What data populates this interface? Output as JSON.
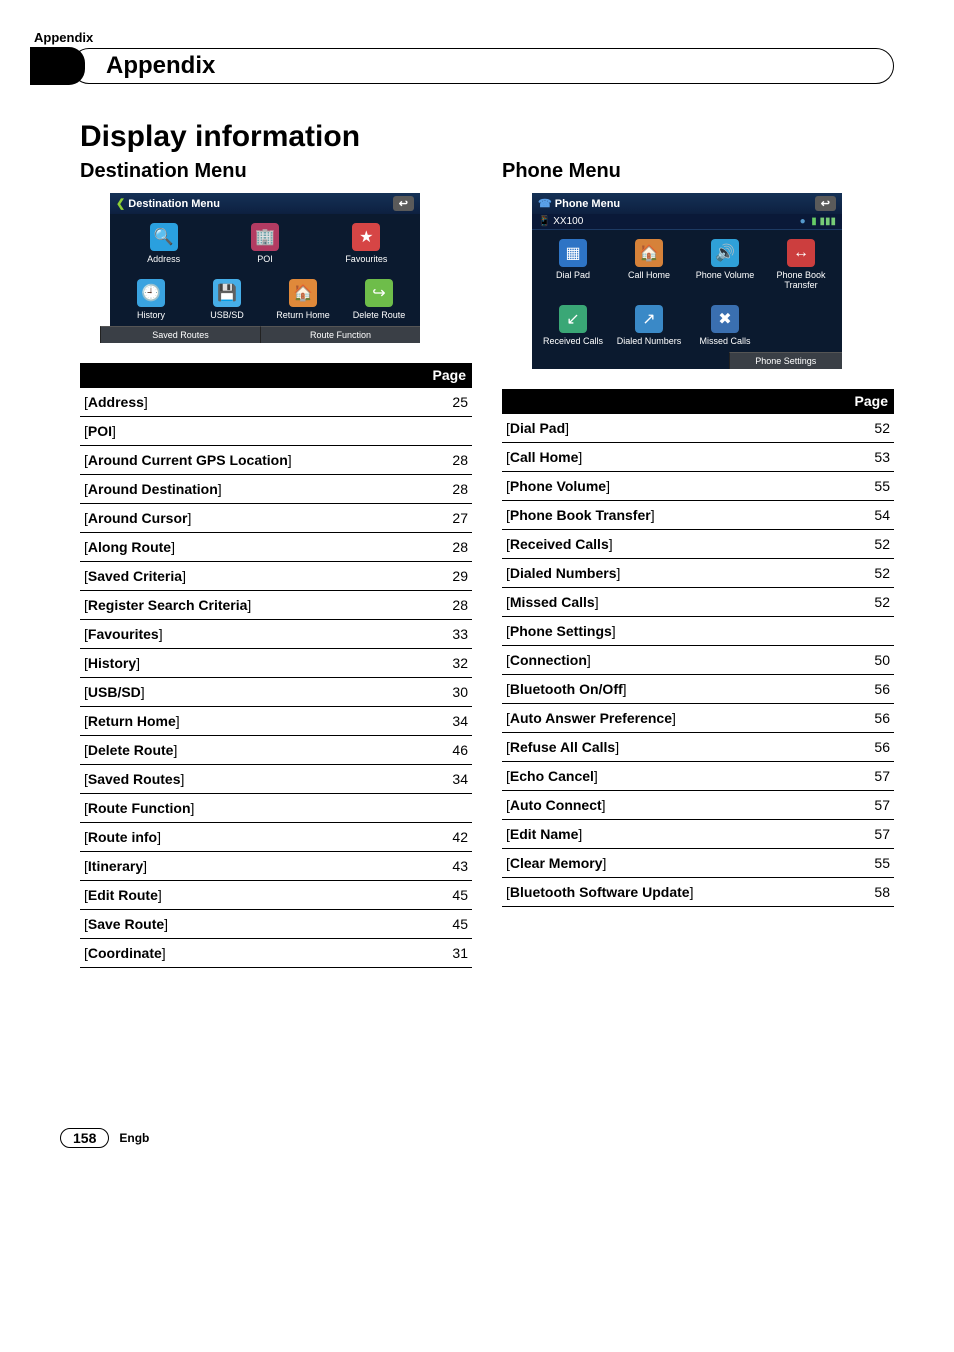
{
  "section_tag": "Appendix",
  "chapter_title": "Appendix",
  "main_heading": "Display information",
  "page_number": "158",
  "language": "Engb",
  "left": {
    "sub_heading": "Destination Menu",
    "screenshot": {
      "title": "Destination Menu",
      "back_icon": "↩",
      "row1": [
        {
          "icon": "🔍",
          "bg": "#2aa0df",
          "label": "Address"
        },
        {
          "icon": "🏢",
          "bg": "#b33b62",
          "label": "POI"
        },
        {
          "icon": "★",
          "bg": "#d64545",
          "label": "Favourites"
        }
      ],
      "row2": [
        {
          "icon": "🕘",
          "bg": "#3aa3e0",
          "label": "History"
        },
        {
          "icon": "💾",
          "bg": "#46aee8",
          "label": "USB/SD"
        },
        {
          "icon": "🏠",
          "bg": "#e0893a",
          "label": "Return Home"
        },
        {
          "icon": "↪",
          "bg": "#6ebd4a",
          "label": "Delete Route"
        }
      ],
      "footer": [
        "Saved Routes",
        "Route Function"
      ]
    },
    "table_header": "Page",
    "rows": [
      {
        "level": 0,
        "label": "Address",
        "page": "25"
      },
      {
        "level": 0,
        "label": "POI",
        "page": ""
      },
      {
        "level": 1,
        "label": "Around Current GPS Location",
        "page": "28"
      },
      {
        "level": 1,
        "label": "Around Destination",
        "page": "28"
      },
      {
        "level": 1,
        "label": "Around Cursor",
        "page": "27"
      },
      {
        "level": 1,
        "label": "Along Route",
        "page": "28"
      },
      {
        "level": 1,
        "label": "Saved Criteria",
        "page": "29"
      },
      {
        "level": 1,
        "label": "Register Search Criteria",
        "page": "28"
      },
      {
        "level": 0,
        "label": "Favourites",
        "page": "33"
      },
      {
        "level": 0,
        "label": "History",
        "page": "32"
      },
      {
        "level": 0,
        "label": "USB/SD",
        "page": "30"
      },
      {
        "level": 0,
        "label": "Return Home",
        "page": "34"
      },
      {
        "level": 0,
        "label": "Delete Route",
        "page": "46"
      },
      {
        "level": 0,
        "label": "Saved Routes",
        "page": "34"
      },
      {
        "level": 0,
        "label": "Route Function",
        "page": ""
      },
      {
        "level": 1,
        "label": "Route info",
        "page": "42"
      },
      {
        "level": 1,
        "label": "Itinerary",
        "page": "43"
      },
      {
        "level": 1,
        "label": "Edit Route",
        "page": "45"
      },
      {
        "level": 1,
        "label": "Save Route",
        "page": "45"
      },
      {
        "level": 1,
        "label": "Coordinate",
        "page": "31"
      }
    ]
  },
  "right": {
    "sub_heading": "Phone Menu",
    "screenshot": {
      "title": "Phone Menu",
      "back_icon": "↩",
      "status_left": "XX100",
      "row1": [
        {
          "icon": "▦",
          "bg": "#2e74c5",
          "label": "Dial Pad"
        },
        {
          "icon": "🏠",
          "bg": "#d6823a",
          "label": "Call Home"
        },
        {
          "icon": "🔊",
          "bg": "#2fa0d8",
          "label": "Phone Volume"
        },
        {
          "icon": "↔",
          "bg": "#cc3e3e",
          "label": "Phone Book Transfer"
        }
      ],
      "row2": [
        {
          "icon": "↙",
          "bg": "#3aa776",
          "label": "Received Calls"
        },
        {
          "icon": "↗",
          "bg": "#3a89c7",
          "label": "Dialed Numbers"
        },
        {
          "icon": "✖",
          "bg": "#3a6fb0",
          "label": "Missed Calls"
        },
        {
          "icon": "",
          "bg": "transparent",
          "label": ""
        }
      ],
      "footer_single": "Phone Settings"
    },
    "table_header": "Page",
    "rows": [
      {
        "level": 0,
        "label": "Dial Pad",
        "page": "52"
      },
      {
        "level": 0,
        "label": "Call Home",
        "page": "53"
      },
      {
        "level": 0,
        "label": "Phone Volume",
        "page": "55"
      },
      {
        "level": 0,
        "label": "Phone Book Transfer",
        "page": "54"
      },
      {
        "level": 0,
        "label": "Received Calls",
        "page": "52"
      },
      {
        "level": 0,
        "label": "Dialed Numbers",
        "page": "52"
      },
      {
        "level": 0,
        "label": "Missed Calls",
        "page": "52"
      },
      {
        "level": 0,
        "label": "Phone Settings",
        "page": ""
      },
      {
        "level": 1,
        "label": "Connection",
        "page": "50"
      },
      {
        "level": 1,
        "label": "Bluetooth On/Off",
        "page": "56"
      },
      {
        "level": 1,
        "label": "Auto Answer Preference",
        "page": "56"
      },
      {
        "level": 1,
        "label": "Refuse All Calls",
        "page": "56"
      },
      {
        "level": 1,
        "label": "Echo Cancel",
        "page": "57"
      },
      {
        "level": 1,
        "label": "Auto Connect",
        "page": "57"
      },
      {
        "level": 1,
        "label": "Edit Name",
        "page": "57"
      },
      {
        "level": 1,
        "label": "Clear Memory",
        "page": "55"
      },
      {
        "level": 1,
        "label": "Bluetooth Software Update",
        "page": "58"
      }
    ]
  }
}
